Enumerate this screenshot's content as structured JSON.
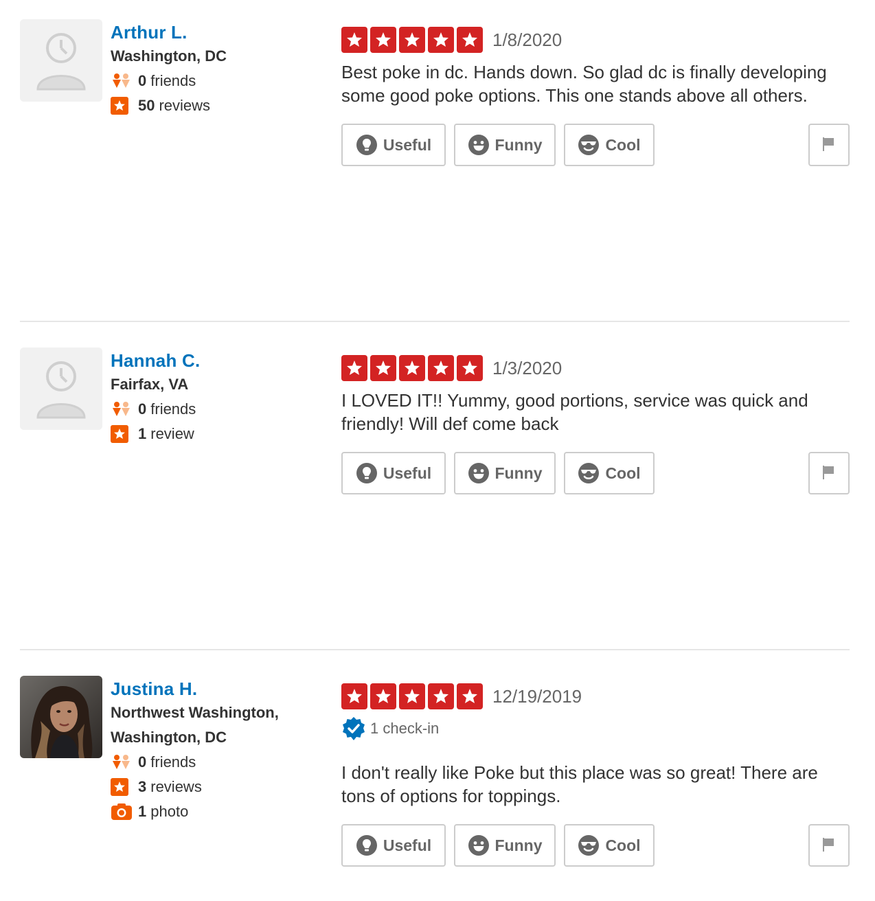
{
  "colors": {
    "link": "#0073bb",
    "star": "#d32323",
    "orange": "#f15c00",
    "verified": "#0073bb",
    "border": "#cccccc"
  },
  "actions": {
    "useful": "Useful",
    "funny": "Funny",
    "cool": "Cool"
  },
  "reviews": [
    {
      "user": {
        "name": "Arthur L.",
        "location": [
          "Washington, DC"
        ],
        "friends_count": "0",
        "friends_label": "friends",
        "reviews_count": "50",
        "reviews_label": "reviews",
        "avatar": "default-avatar"
      },
      "rating": 5,
      "date": "1/8/2020",
      "text": "Best poke in dc. Hands down. So glad dc is finally developing some good poke options. This one stands above all others."
    },
    {
      "user": {
        "name": "Hannah C.",
        "location": [
          "Fairfax, VA"
        ],
        "friends_count": "0",
        "friends_label": "friends",
        "reviews_count": "1",
        "reviews_label": "review",
        "avatar": "default-avatar"
      },
      "rating": 5,
      "date": "1/3/2020",
      "text": "I LOVED IT!! Yummy, good portions, service was quick and friendly! Will def come back"
    },
    {
      "user": {
        "name": "Justina H.",
        "location": [
          "Northwest Washington,",
          "Washington, DC"
        ],
        "friends_count": "0",
        "friends_label": "friends",
        "reviews_count": "3",
        "reviews_label": "reviews",
        "photos_count": "1",
        "photos_label": "photo",
        "avatar": "user-photo"
      },
      "rating": 5,
      "date": "12/19/2019",
      "checkin": "1 check-in",
      "text": "I don't really like Poke but this place was so great! There are tons of options for toppings."
    }
  ]
}
